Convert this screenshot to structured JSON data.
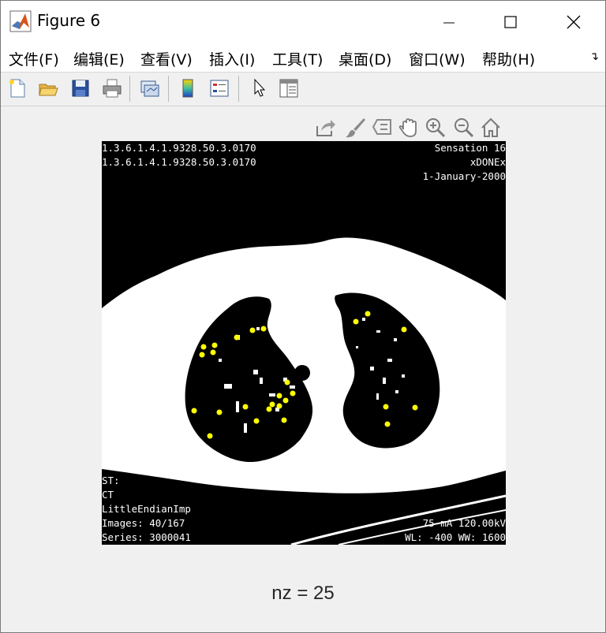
{
  "window": {
    "title": "Figure 6"
  },
  "menubar": {
    "items": [
      "文件(F)",
      "编辑(E)",
      "查看(V)",
      "插入(I)",
      "工具(T)",
      "桌面(D)",
      "窗口(W)",
      "帮助(H)"
    ]
  },
  "toolbar": {
    "buttons": [
      "new-figure-icon",
      "open-file-icon",
      "save-icon",
      "print-icon",
      "link-plot-icon",
      "colorbar-icon",
      "legend-icon",
      "edit-plot-arrow-icon",
      "property-inspector-icon"
    ]
  },
  "axes_toolbar": {
    "buttons": [
      "export-icon",
      "brush-icon",
      "data-tips-icon",
      "pan-icon",
      "zoom-in-icon",
      "zoom-out-icon",
      "home-icon"
    ]
  },
  "image_overlay": {
    "top_left": [
      "1.3.6.1.4.1.9328.50.3.0170",
      "1.3.6.1.4.1.9328.50.3.0170"
    ],
    "top_right": [
      "Sensation 16",
      "xDONEx",
      "1-January-2000"
    ],
    "bottom_left": [
      "ST:",
      "CT",
      "LittleEndianImp",
      "Images: 40/167",
      "Series: 3000041"
    ],
    "bottom_right": [
      "75 mA 120.00kV",
      "WL: -400 WW: 1600"
    ]
  },
  "xlabel": "nz = 25",
  "colors": {
    "marker": "#ffff00",
    "background": "#f0f0f0"
  }
}
